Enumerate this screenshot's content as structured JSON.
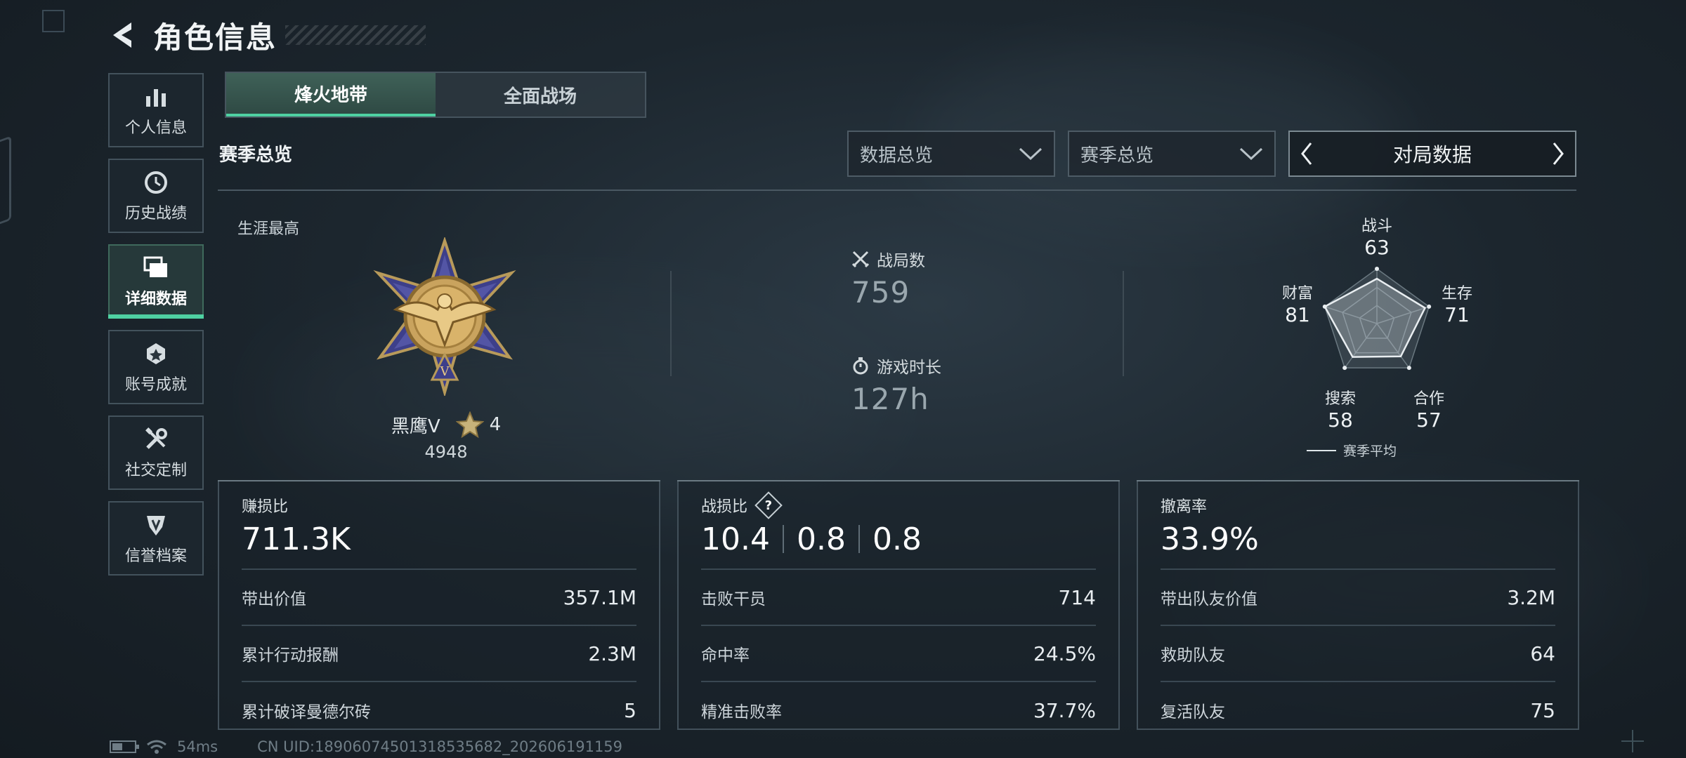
{
  "header": {
    "title": "角色信息"
  },
  "nav": [
    {
      "label": "个人信息",
      "icon": "bar-chart-icon"
    },
    {
      "label": "历史战绩",
      "icon": "history-clock-icon"
    },
    {
      "label": "详细数据",
      "icon": "cards-icon",
      "active": true
    },
    {
      "label": "账号成就",
      "icon": "achievement-icon"
    },
    {
      "label": "社交定制",
      "icon": "tools-icon"
    },
    {
      "label": "信誉档案",
      "icon": "shield-icon"
    }
  ],
  "mode_tabs": [
    {
      "label": "烽火地带",
      "active": true
    },
    {
      "label": "全面战场",
      "active": false
    }
  ],
  "section_title": "赛季总览",
  "filters": {
    "dropdown1": "数据总览",
    "dropdown2": "赛季总览",
    "switcher": "对局数据"
  },
  "career": {
    "label": "生涯最高",
    "rank_name": "黑鹰V",
    "stars": "4",
    "score": "4948"
  },
  "stats": {
    "matches_label": "战局数",
    "matches_value": "759",
    "playtime_label": "游戏时长",
    "playtime_value": "127h"
  },
  "radar": {
    "legend": "赛季平均",
    "axes": [
      {
        "label": "战斗",
        "value": "63"
      },
      {
        "label": "生存",
        "value": "71"
      },
      {
        "label": "合作",
        "value": "57"
      },
      {
        "label": "搜索",
        "value": "58"
      },
      {
        "label": "财富",
        "value": "81"
      }
    ]
  },
  "cards": {
    "profit": {
      "title": "赚损比",
      "main": "711.3K",
      "rows": [
        {
          "k": "带出价值",
          "v": "357.1M"
        },
        {
          "k": "累计行动报酬",
          "v": "2.3M"
        },
        {
          "k": "累计破译曼德尔砖",
          "v": "5"
        }
      ]
    },
    "kd": {
      "title": "战损比",
      "help": "?",
      "main": [
        "10.4",
        "0.8",
        "0.8"
      ],
      "rows": [
        {
          "k": "击败干员",
          "v": "714"
        },
        {
          "k": "命中率",
          "v": "24.5%"
        },
        {
          "k": "精准击败率",
          "v": "37.7%"
        }
      ]
    },
    "extract": {
      "title": "撤离率",
      "main": "33.9%",
      "rows": [
        {
          "k": "带出队友价值",
          "v": "3.2M"
        },
        {
          "k": "救助队友",
          "v": "64"
        },
        {
          "k": "复活队友",
          "v": "75"
        }
      ]
    }
  },
  "footer": {
    "ping": "54ms",
    "uid": "CN UID:18906074501318535682_202606191159"
  },
  "colors": {
    "accent": "#4fd1a2",
    "bg": "#1c262e"
  }
}
